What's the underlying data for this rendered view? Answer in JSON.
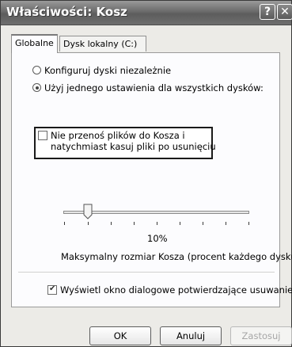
{
  "window": {
    "title": "Właściwości: Kosz",
    "help_glyph": "?",
    "close_glyph": "✕"
  },
  "tabs": [
    {
      "label": "Globalne"
    },
    {
      "label": "Dysk lokalny (C:)"
    }
  ],
  "options": {
    "configure_independently": "Konfiguruj dyski niezależnie",
    "use_single_setting": "Użyj jednego ustawienia dla wszystkich dysków:",
    "selected": "use_single_setting"
  },
  "dont_move_to_recycle": {
    "line1": "Nie przenoś plików do Kosza i",
    "line2": "natychmiast kasuj pliki po usunięciu",
    "checked": false
  },
  "slider": {
    "value_percent": 10,
    "value_label": "10%",
    "caption": "Maksymalny rozmiar Kosza (procent każdego dysku)"
  },
  "confirm_dialog": {
    "label": "Wyświetl okno dialogowe potwierdzające usuwanie",
    "checked": true
  },
  "buttons": {
    "ok": "OK",
    "cancel": "Anuluj",
    "apply": "Zastosuj"
  }
}
